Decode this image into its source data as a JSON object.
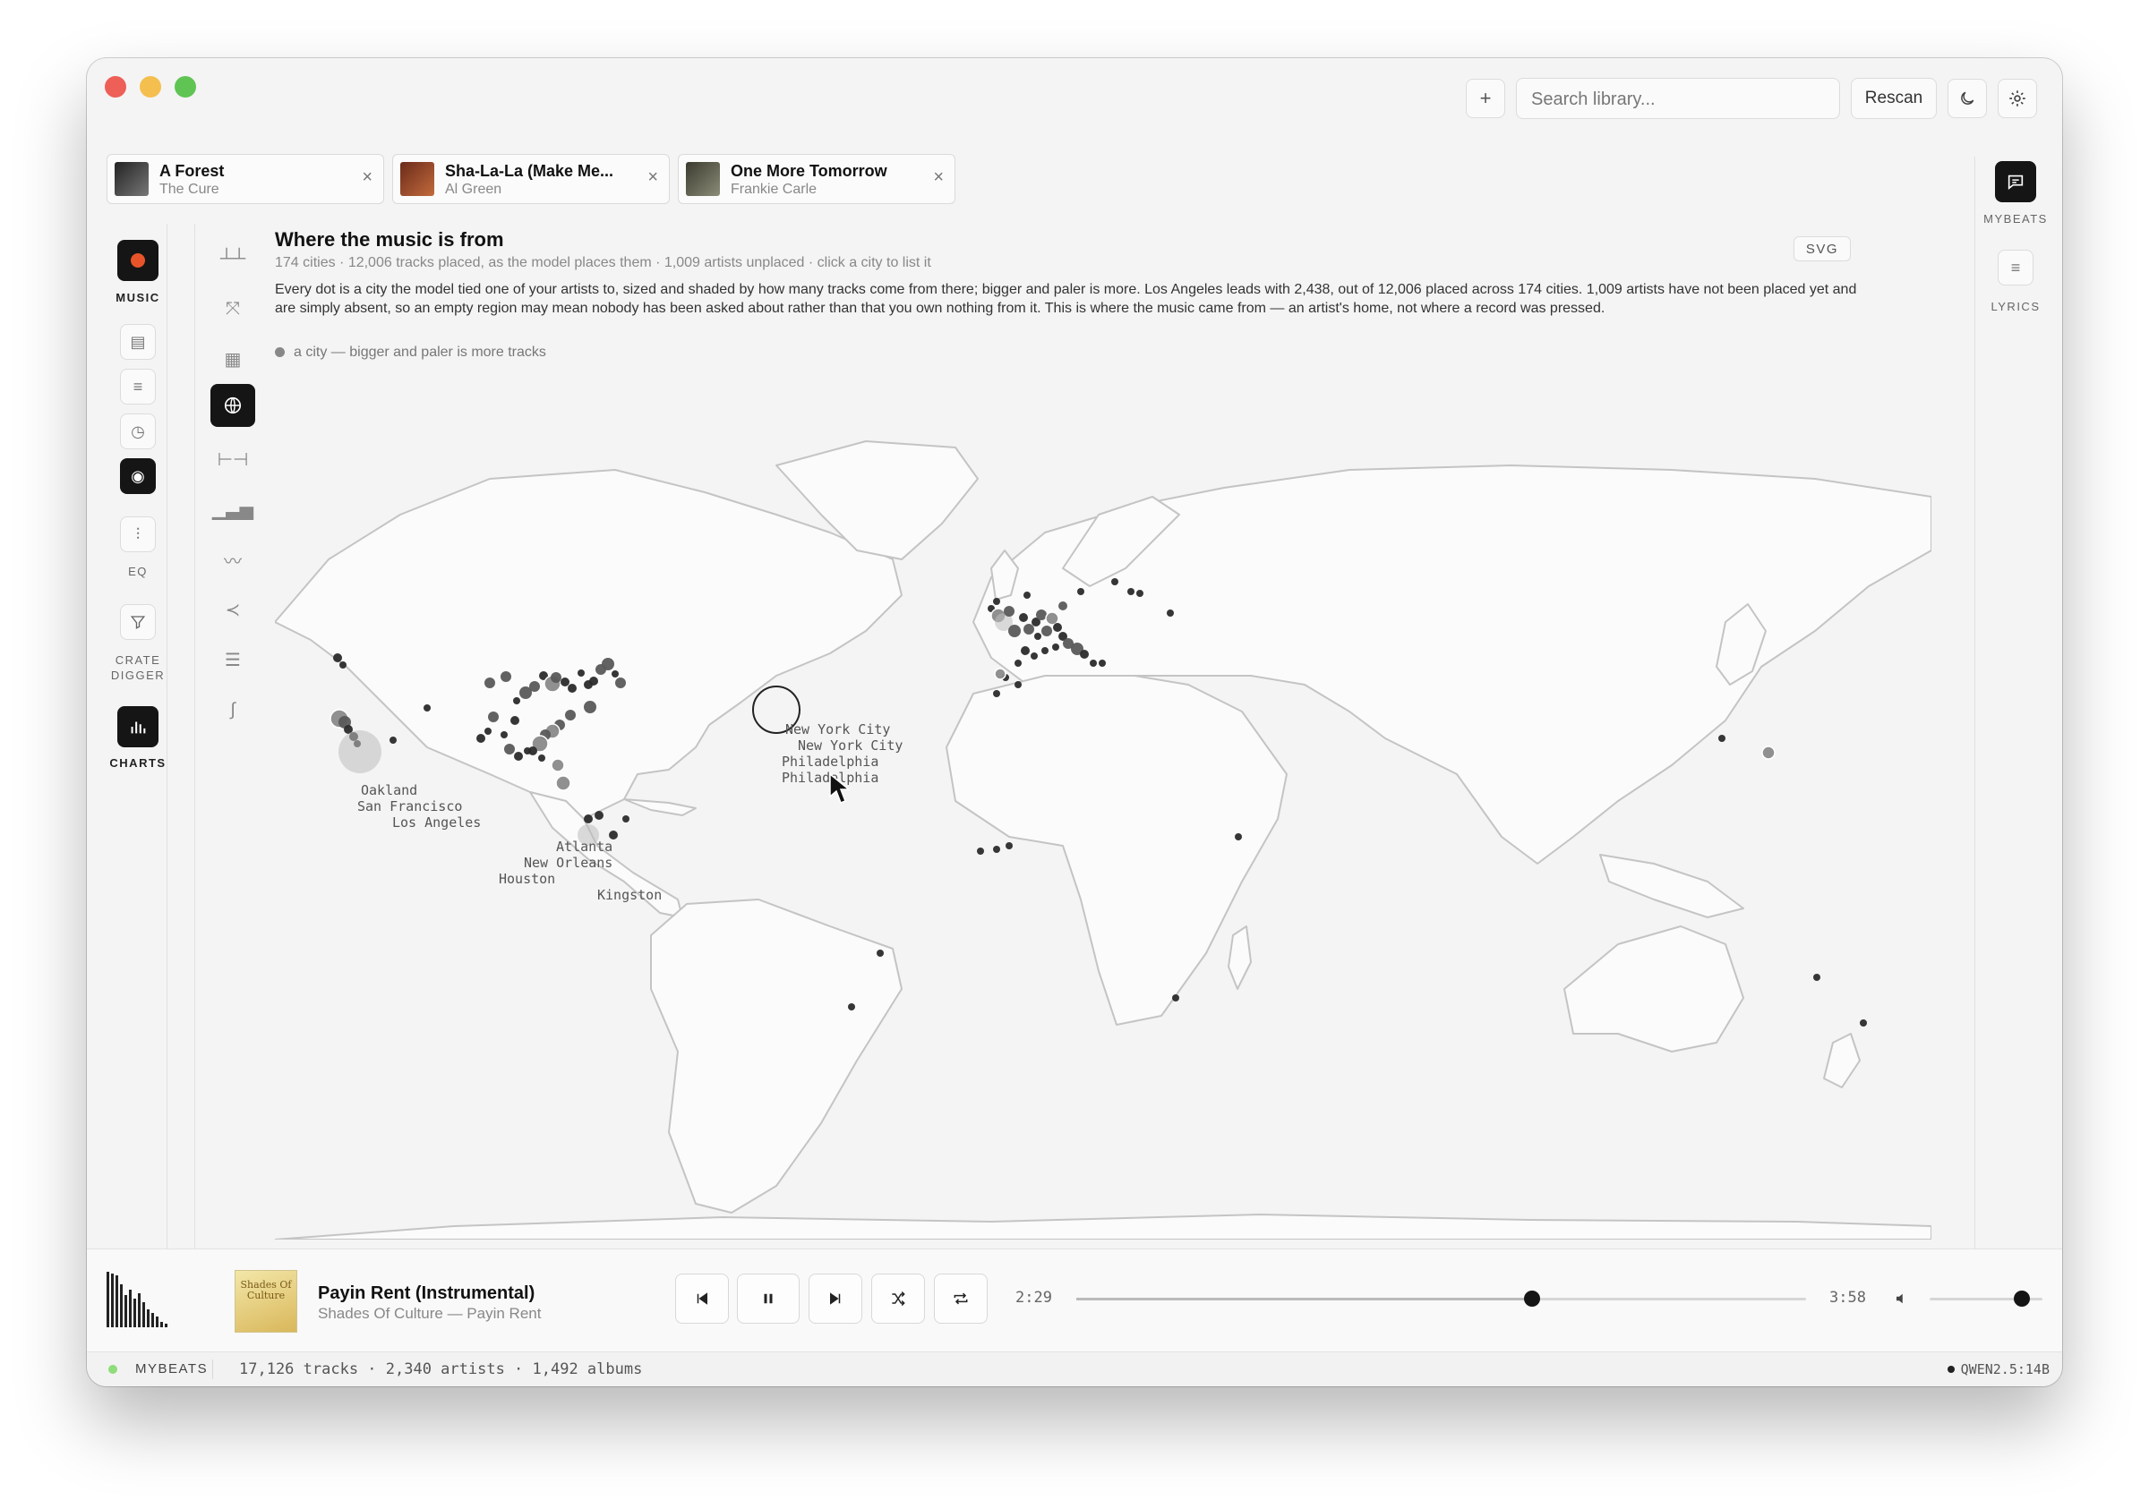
{
  "toolbar": {
    "add_label": "+",
    "search_placeholder": "Search library...",
    "rescan_label": "Rescan"
  },
  "queue_tabs": [
    {
      "title": "A Forest",
      "artist": "The Cure",
      "close": "×"
    },
    {
      "title": "Sha-La-La (Make Me...",
      "artist": "Al Green",
      "close": "×"
    },
    {
      "title": "One More Tomorrow",
      "artist": "Frankie Carle",
      "close": "×"
    }
  ],
  "left_rail": {
    "music": "MUSIC",
    "eq": "EQ",
    "crate": "CRATE DIGGER",
    "charts": "CHARTS"
  },
  "right_rail": {
    "mybeats": "MYBEATS",
    "lyrics": "LYRICS"
  },
  "view": {
    "title": "Where the music is from",
    "subtitle": "174 cities · 12,006 tracks placed, as the model places them · 1,009 artists unplaced · click a city to list it",
    "description": "Every dot is a city the model tied one of your artists to, sized and shaded by how many tracks come from there; bigger and paler is more. Los Angeles leads with 2,438, out of 12,006 placed across 174 cities. 1,009 artists have not been placed yet and are simply absent, so an empty region may mean nobody has been asked about rather than that you own nothing from it. This is where the music came from — an artist's home, not where a record was pressed.",
    "legend": "a city — bigger and paler is more tracks",
    "svg_button": "SVG"
  },
  "map_labels": [
    "New York City",
    "New York City",
    "Philadelphia",
    "Philadelphia",
    "Oakland",
    "San Francisco",
    "Los Angeles",
    "Atlanta",
    "New Orleans",
    "Houston",
    "Kingston"
  ],
  "player": {
    "title": "Payin Rent (Instrumental)",
    "subtitle": "Shades Of Culture — Payin Rent",
    "elapsed": "2:29",
    "duration": "3:58",
    "progress": 0.625,
    "volume": 0.82,
    "art_text": "Shades Of Culture"
  },
  "status": {
    "app": "MYBEATS",
    "stats": "17,126 tracks · 2,340 artists · 1,492 albums",
    "model": "QWEN2.5:14B"
  },
  "colors": {
    "accent": "#e8542a",
    "dot_dark": "#2b2b2b",
    "dot_light": "#bdbdbd",
    "land": "#fbfbfb",
    "ocean": "#f4f4f4"
  }
}
